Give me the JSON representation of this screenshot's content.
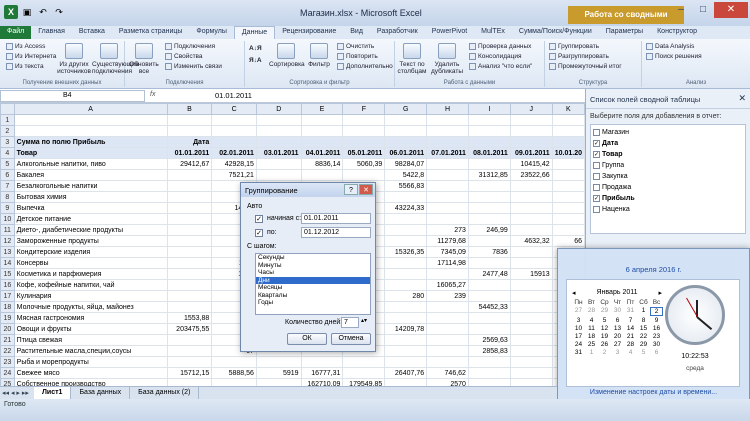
{
  "window": {
    "title": "Магазин.xlsx  -  Microsoft Excel",
    "context_tab": "Работа со сводными таблицами"
  },
  "tabs": [
    "Файл",
    "Главная",
    "Вставка",
    "Разметка страницы",
    "Формулы",
    "Данные",
    "Рецензирование",
    "Вид",
    "Разработчик",
    "PowerPivot",
    "MulTEx",
    "Сумма/Поиск/Функции",
    "Параметры",
    "Конструктор"
  ],
  "ribbon": {
    "ext_data": [
      "Из Access",
      "Из Интернета",
      "Из текста"
    ],
    "other_sources": "Из других источников",
    "existing": "Существующие подключения",
    "refresh_all": "Обновить все",
    "conn_items": [
      "Подключения",
      "Свойства",
      "Изменить связи"
    ],
    "sort": "Сортировка",
    "filter": "Фильтр",
    "filter_items": [
      "Очистить",
      "Повторить",
      "Дополнительно"
    ],
    "text_to_cols": "Текст по столбцам",
    "remove_dup": "Удалить дубликаты",
    "data_tools": [
      "Проверка данных",
      "Консолидация",
      "Анализ \"что если\""
    ],
    "outline": [
      "Группировать",
      "Разгруппировать",
      "Промежуточный итог"
    ],
    "analysis": [
      "Data Analysis",
      "Поиск решения"
    ],
    "groups": [
      "Получение внешних данных",
      "Подключения",
      "Сортировка и фильтр",
      "Работа с данными",
      "Структура",
      "Анализ"
    ]
  },
  "formula": {
    "cell": "B4",
    "fx": "fx",
    "value": "01.01.2011"
  },
  "sheet": {
    "cols": [
      "A",
      "B",
      "C",
      "D",
      "E",
      "F",
      "G",
      "H",
      "I",
      "J",
      "K"
    ],
    "row1": "1",
    "row2": "2",
    "r3": [
      "3",
      "Сумма по полю Прибыль",
      "Дата",
      "",
      "",
      "",
      "",
      "",
      "",
      "",
      "",
      ""
    ],
    "r4": [
      "4",
      "Товар",
      "01.01.2011",
      "02.01.2011",
      "03.01.2011",
      "04.01.2011",
      "05.01.2011",
      "06.01.2011",
      "07.01.2011",
      "08.01.2011",
      "09.01.2011",
      "10.01.20"
    ],
    "rows": [
      [
        "5",
        "Алкогольные напитки, пиво",
        "29412,67",
        "42928,15",
        "",
        "8836,14",
        "5060,39",
        "98284,07",
        "",
        "",
        "10415,42",
        ""
      ],
      [
        "6",
        "Бакалея",
        "",
        "7521,21",
        "",
        "",
        "",
        "5422,8",
        "",
        "31312,85",
        "23522,66",
        ""
      ],
      [
        "7",
        "Безалкогольные напитки",
        "",
        "",
        "",
        "",
        "",
        "5566,83",
        "",
        "",
        "",
        ""
      ],
      [
        "8",
        "Бытовая химия",
        "",
        "",
        "",
        "",
        "",
        "",
        "",
        "",
        "",
        ""
      ],
      [
        "9",
        "Выпечка",
        "",
        "14337",
        "",
        "",
        "",
        "43224,33",
        "",
        "",
        "",
        ""
      ],
      [
        "10",
        "Детское питание",
        "",
        "4",
        "",
        "",
        "",
        "",
        "",
        "",
        "",
        ""
      ],
      [
        "11",
        "Дието-, диабетические продукты",
        "",
        "",
        "",
        "",
        "",
        "",
        "273",
        "246,99",
        "",
        ""
      ],
      [
        "12",
        "Замороженные продукты",
        "",
        "",
        "",
        "",
        "",
        "",
        "11279,68",
        "",
        "4632,32",
        "66"
      ],
      [
        "13",
        "Кондитерские изделия",
        "",
        "",
        "",
        "",
        "",
        "15326,35",
        "7345,09",
        "7836",
        "",
        ""
      ],
      [
        "14",
        "Консервы",
        "",
        "1182",
        "",
        "",
        "",
        "",
        "17114,98",
        "",
        "",
        ""
      ],
      [
        "15",
        "Косметика и парфюмерия",
        "",
        "1718",
        "",
        "",
        "",
        "",
        "",
        "2477,48",
        "15913",
        ""
      ],
      [
        "16",
        "Кофе, кофейные напитки, чай",
        "",
        "",
        "",
        "",
        "",
        "",
        "16065,27",
        "",
        "",
        ""
      ],
      [
        "17",
        "Кулинария",
        "",
        "",
        "",
        "",
        "",
        "280",
        "239",
        "",
        "",
        ""
      ],
      [
        "18",
        "Молочные продукты, яйца, майонез",
        "",
        "461",
        "",
        "",
        "",
        "",
        "",
        "54452,33",
        "",
        ""
      ],
      [
        "19",
        "Мясная гастрономия",
        "1553,88",
        "",
        "",
        "",
        "",
        "",
        "",
        "",
        "",
        ""
      ],
      [
        "20",
        "Овощи и фрукты",
        "203475,55",
        "",
        "",
        "",
        "",
        "14209,78",
        "",
        "",
        "",
        ""
      ],
      [
        "21",
        "Птица свежая",
        "",
        "",
        "",
        "",
        "",
        "",
        "",
        "2569,63",
        "",
        ""
      ],
      [
        "22",
        "Растительные масла,специи,соусы",
        "",
        "67",
        "",
        "",
        "",
        "",
        "",
        "2858,83",
        "",
        ""
      ],
      [
        "23",
        "Рыба и морепродукты",
        "",
        "",
        "",
        "",
        "",
        "",
        "",
        "",
        "",
        ""
      ],
      [
        "24",
        "Свежее мясо",
        "15712,15",
        "5888,56",
        "5919",
        "16777,31",
        "",
        "26407,76",
        "746,62",
        "",
        "",
        ""
      ],
      [
        "25",
        "Собственное производство",
        "",
        "",
        "",
        "162710,09",
        "179549,85",
        "",
        "2570",
        "",
        "",
        ""
      ],
      [
        "26",
        "",
        "",
        "",
        "",
        "",
        "",
        "",
        "",
        "",
        "",
        ""
      ]
    ]
  },
  "dialog": {
    "title": "Группирование",
    "auto": "Авто",
    "start_label": "начиная с:",
    "start_value": "01.01.2011",
    "end_label": "по:",
    "end_value": "01.12.2012",
    "step_label": "С шагом:",
    "steps": [
      "Секунды",
      "Минуты",
      "Часы",
      "Дни",
      "Месяцы",
      "Кварталы",
      "Годы"
    ],
    "selected_step": "Дни",
    "days_label": "Количество дней:",
    "days_value": "7",
    "ok": "ОК",
    "cancel": "Отмена"
  },
  "pane": {
    "title": "Список полей сводной таблицы",
    "subtitle": "Выберите поля для добавления в отчет:",
    "fields": [
      {
        "name": "Магазин",
        "checked": false
      },
      {
        "name": "Дата",
        "checked": true
      },
      {
        "name": "Товар",
        "checked": true
      },
      {
        "name": "Группа",
        "checked": false
      },
      {
        "name": "Закупка",
        "checked": false
      },
      {
        "name": "Продажа",
        "checked": false
      },
      {
        "name": "Прибыль",
        "checked": true
      },
      {
        "name": "Наценка",
        "checked": false
      }
    ]
  },
  "gadget": {
    "date_line": "6 апреля 2016 г.",
    "month": "Январь 2011",
    "weekdays": [
      "Пн",
      "Вт",
      "Ср",
      "Чт",
      "Пт",
      "Сб",
      "Вс"
    ],
    "days": [
      "27",
      "28",
      "29",
      "30",
      "31",
      "1",
      "2",
      "3",
      "4",
      "5",
      "6",
      "7",
      "8",
      "9",
      "10",
      "11",
      "12",
      "13",
      "14",
      "15",
      "16",
      "17",
      "18",
      "19",
      "20",
      "21",
      "22",
      "23",
      "24",
      "25",
      "26",
      "27",
      "28",
      "29",
      "30",
      "31",
      "1",
      "2",
      "3",
      "4",
      "5",
      "6"
    ],
    "time": "10:22:53",
    "day": "среда",
    "link": "Изменение настроек даты и времени..."
  },
  "bottom": {
    "sheet_tabs": [
      "Лист1",
      "База данных",
      "База данных (2)"
    ],
    "status": "Готово"
  }
}
